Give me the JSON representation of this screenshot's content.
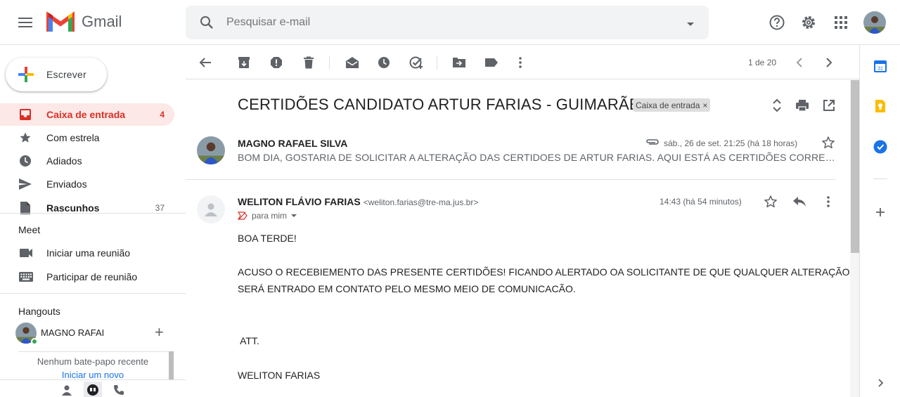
{
  "header": {
    "app_name": "Gmail",
    "search_placeholder": "Pesquisar e-mail"
  },
  "sidebar": {
    "compose_label": "Escrever",
    "items": [
      {
        "label": "Caixa de entrada",
        "count": "4"
      },
      {
        "label": "Com estrela",
        "count": ""
      },
      {
        "label": "Adiados",
        "count": ""
      },
      {
        "label": "Enviados",
        "count": ""
      },
      {
        "label": "Rascunhos",
        "count": "37"
      }
    ],
    "meet": {
      "title": "Meet",
      "items": [
        {
          "label": "Iniciar uma reunião"
        },
        {
          "label": "Participar de reunião"
        }
      ]
    },
    "hangouts": {
      "title": "Hangouts",
      "user_name": "MAGNO RAFAI",
      "add_label": "+",
      "empty_text": "Nenhum bate-papo recente",
      "start_link": "Iniciar um novo"
    }
  },
  "toolbar": {
    "pager": "1 de 20"
  },
  "thread": {
    "subject": "CERTIDÕES CANDIDATO ARTUR FARIAS - GUIMARÃES",
    "label_chip": "Caixa de entrada",
    "label_chip_close": "×",
    "message1": {
      "from": "MAGNO RAFAEL SILVA",
      "date": "sáb., 26 de set. 21:25 (há 18 horas)",
      "snippet": "BOM DIA, GOSTARIA DE SOLICITAR A ALTERAÇÃO DAS CERTIDOES DE ARTUR FARIAS. AQUI ESTÁ AS CERTIDÕES CORRETAS..."
    },
    "message2": {
      "from_name": "WELITON FLÁVIO FARIAS",
      "from_email": "<weliton.farias@tre-ma.jus.br>",
      "to": "para mim",
      "date": "14:43 (há 54 minutos)",
      "body": [
        "BOA TERDE!",
        "ACUSO O RECEBIEMENTO DAS PRESENTE CERTIDÕES! FICANDO ALERTADO OA SOLICITANTE  DE  QUE QUALQUER ALTERAÇÃO",
        "SERÁ ENTRADO EM CONTATO PELO MESMO MEIO DE COMUNICACÃO.",
        " ATT.",
        "WELITON FARIAS"
      ]
    }
  },
  "colors": {
    "active_red": "#d93025",
    "active_bg": "#fce8e6",
    "link_blue": "#1a73e8",
    "online_green": "#34a853"
  }
}
